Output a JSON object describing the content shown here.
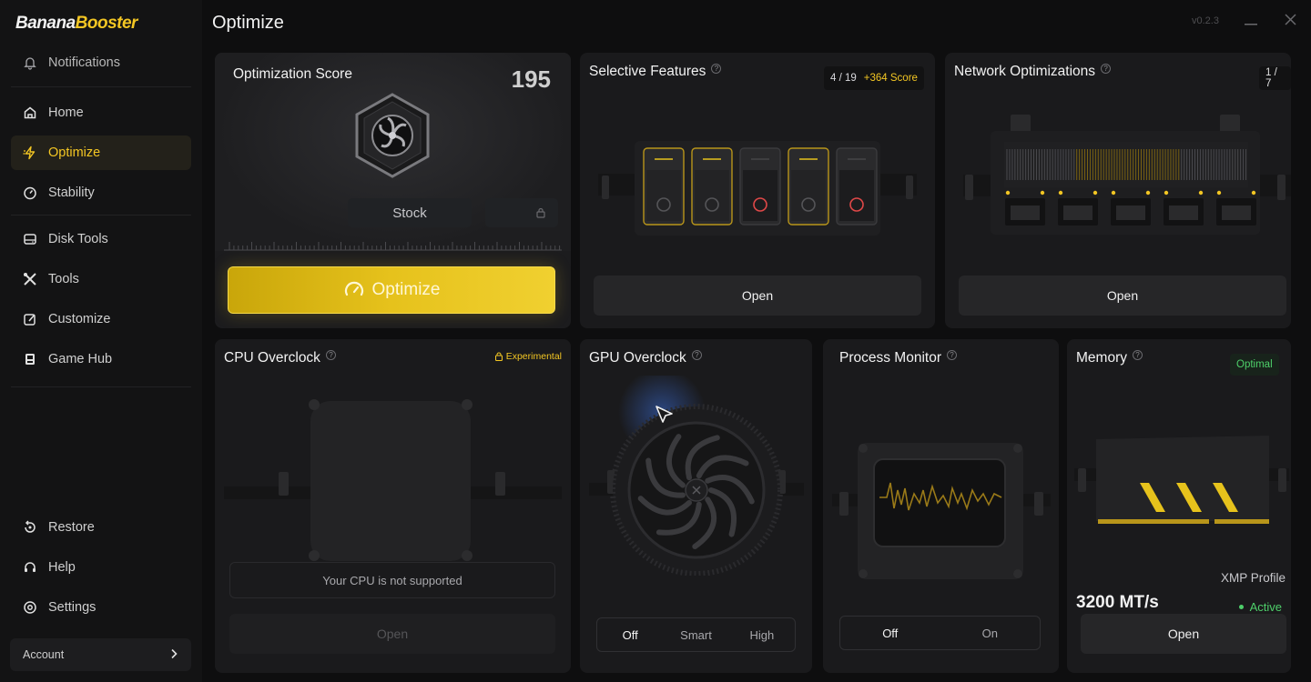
{
  "app": {
    "brand_part1": "Banana",
    "brand_part2": "Booster",
    "page_title": "Optimize",
    "version": "v0.2.3",
    "accent": "#f3c623"
  },
  "sidebar": {
    "notifications": {
      "label": "Notifications",
      "icon": "bell-icon"
    },
    "items": [
      {
        "label": "Home",
        "icon": "home-icon"
      },
      {
        "label": "Optimize",
        "icon": "lightning-icon",
        "active": true
      },
      {
        "label": "Stability",
        "icon": "gauge-icon"
      },
      {
        "label": "Disk Tools",
        "icon": "disk-icon"
      },
      {
        "label": "Tools",
        "icon": "tools-icon"
      },
      {
        "label": "Customize",
        "icon": "edit-icon"
      },
      {
        "label": "Game Hub",
        "icon": "gamepad-icon"
      }
    ],
    "bottom_items": [
      {
        "label": "Restore",
        "icon": "restore-icon"
      },
      {
        "label": "Help",
        "icon": "headset-icon"
      },
      {
        "label": "Settings",
        "icon": "gear-icon"
      }
    ],
    "account_label": "Account"
  },
  "score_card": {
    "title": "Optimization Score",
    "score": "195",
    "profile": "Stock",
    "button": "Optimize"
  },
  "selective": {
    "title": "Selective Features",
    "count": "4 / 19",
    "score_boost": "+364 Score",
    "open": "Open"
  },
  "network": {
    "title": "Network Optimizations",
    "count": "1 / 7",
    "open": "Open"
  },
  "cpu": {
    "title": "CPU Overclock",
    "tag": "Experimental",
    "notice": "Your CPU is not supported",
    "open": "Open"
  },
  "gpu": {
    "title": "GPU Overclock",
    "modes": [
      "Off",
      "Smart",
      "High"
    ],
    "selected": "Off"
  },
  "process": {
    "title": "Process Monitor",
    "modes": [
      "Off",
      "On"
    ],
    "selected": "Off"
  },
  "memory": {
    "title": "Memory",
    "status": "Optimal",
    "xmp_label": "XMP Profile",
    "speed": "3200 MT/s",
    "xmp_state": "Active",
    "open": "Open"
  }
}
